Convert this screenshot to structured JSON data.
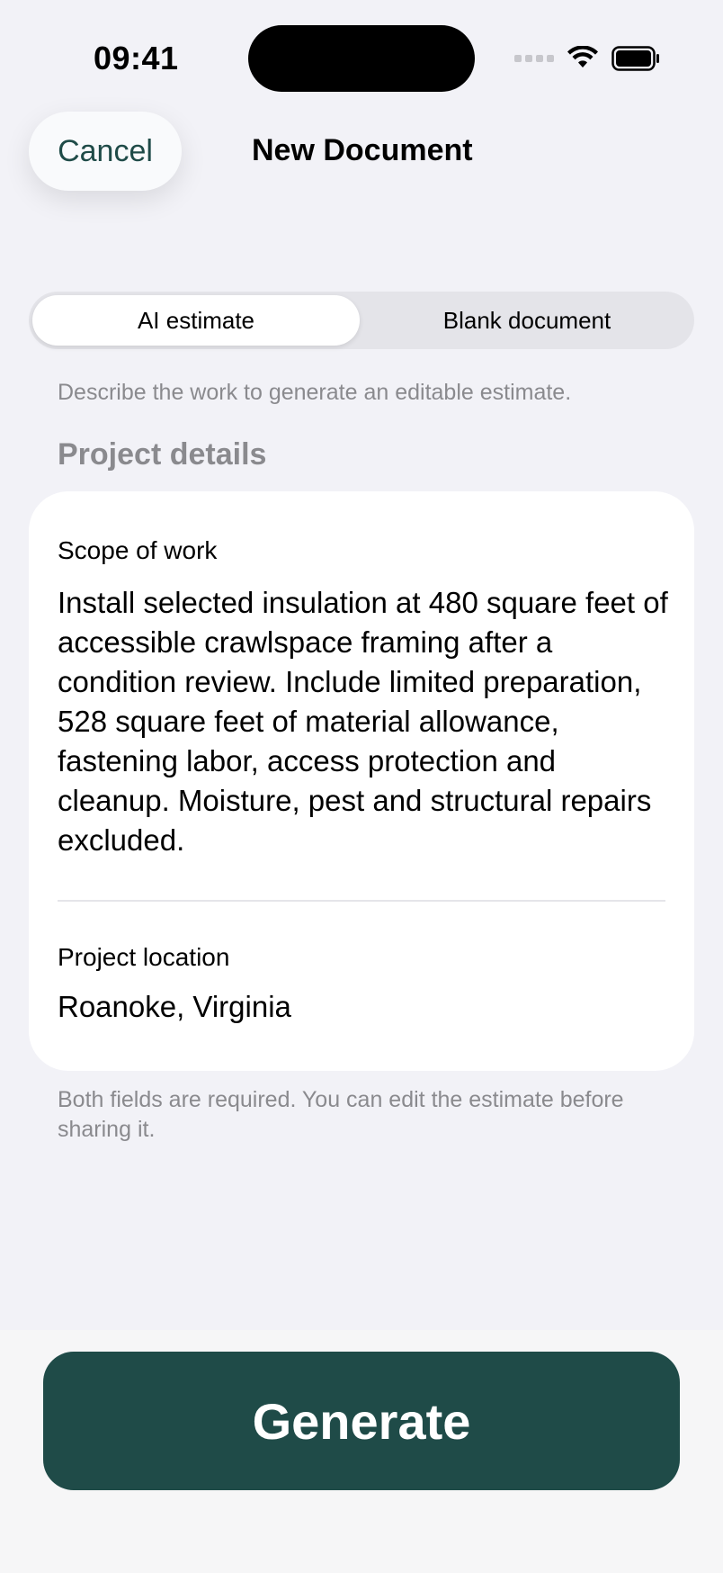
{
  "status_bar": {
    "time": "09:41"
  },
  "nav": {
    "cancel_label": "Cancel",
    "title": "New Document"
  },
  "segmented": {
    "options": [
      {
        "label": "AI estimate",
        "selected": true
      },
      {
        "label": "Blank document",
        "selected": false
      }
    ]
  },
  "helper_text": "Describe the work to generate an editable estimate.",
  "section_title": "Project details",
  "form": {
    "scope_label": "Scope of work",
    "scope_value": "Install selected insulation at 480 square feet of accessible crawlspace framing after a condition review. Include limited preparation, 528 square feet of material allowance, fastening labor, access protection and cleanup. Moisture, pest and structural repairs excluded.",
    "location_label": "Project location",
    "location_value": "Roanoke, Virginia"
  },
  "footer_note": "Both fields are required. You can edit the estimate before sharing it.",
  "generate_label": "Generate",
  "colors": {
    "accent": "#1F4B48",
    "background": "#F2F2F7",
    "secondary_text": "#8A8A8E"
  },
  "icons": {
    "signal": "cellular-signal-icon",
    "wifi": "wifi-icon",
    "battery": "battery-icon"
  }
}
